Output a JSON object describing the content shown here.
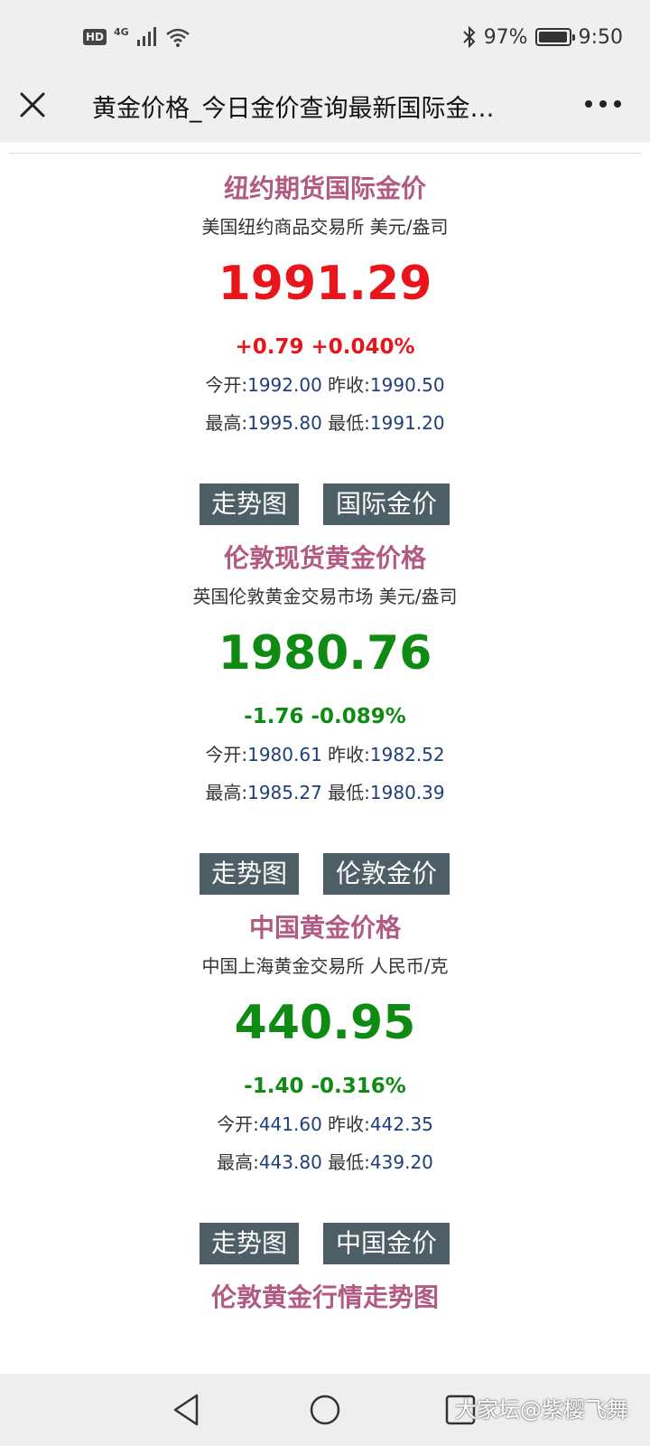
{
  "status_bar": {
    "hd": "HD",
    "network": "4G",
    "battery_percent": "97%",
    "battery_level": 0.97,
    "time": "9:50"
  },
  "title_bar": {
    "title": "黄金价格_今日金价查询最新国际金…",
    "icons": {
      "close": "close-icon",
      "more": "more-icon"
    }
  },
  "sections": [
    {
      "title": "纽约期货国际金价",
      "subtitle": "美国纽约商品交易所 美元/盎司",
      "price": "1991.29",
      "change": "+0.79 +0.040%",
      "trend": "up",
      "open_label": "今开:",
      "open": "1992.00",
      "prev_label": "昨收:",
      "prev": "1990.50",
      "high_label": "最高:",
      "high": "1995.80",
      "low_label": "最低:",
      "low": "1991.20",
      "buttons": [
        "走势图",
        "国际金价"
      ]
    },
    {
      "title": "伦敦现货黄金价格",
      "subtitle": "英国伦敦黄金交易市场 美元/盎司",
      "price": "1980.76",
      "change": "-1.76 -0.089%",
      "trend": "down",
      "open_label": "今开:",
      "open": "1980.61",
      "prev_label": "昨收:",
      "prev": "1982.52",
      "high_label": "最高:",
      "high": "1985.27",
      "low_label": "最低:",
      "low": "1980.39",
      "buttons": [
        "走势图",
        "伦敦金价"
      ]
    },
    {
      "title": "中国黄金价格",
      "subtitle": "中国上海黄金交易所 人民币/克",
      "price": "440.95",
      "change": "-1.40 -0.316%",
      "trend": "down",
      "open_label": "今开:",
      "open": "441.60",
      "prev_label": "昨收:",
      "prev": "442.35",
      "high_label": "最高:",
      "high": "443.80",
      "low_label": "最低:",
      "low": "439.20",
      "buttons": [
        "走势图",
        "中国金价"
      ]
    }
  ],
  "bottom_heading": "伦敦黄金行情走势图",
  "colors": {
    "title": "#b25a82",
    "up": "#e8151a",
    "down": "#0f8a12",
    "value": "#1e3f78",
    "button": "#4e5e66"
  },
  "nav_bar": {
    "icons": {
      "back": "back-icon",
      "home": "home-icon",
      "recents": "recents-icon"
    },
    "watermark": "大家坛@紫樱飞舞"
  }
}
